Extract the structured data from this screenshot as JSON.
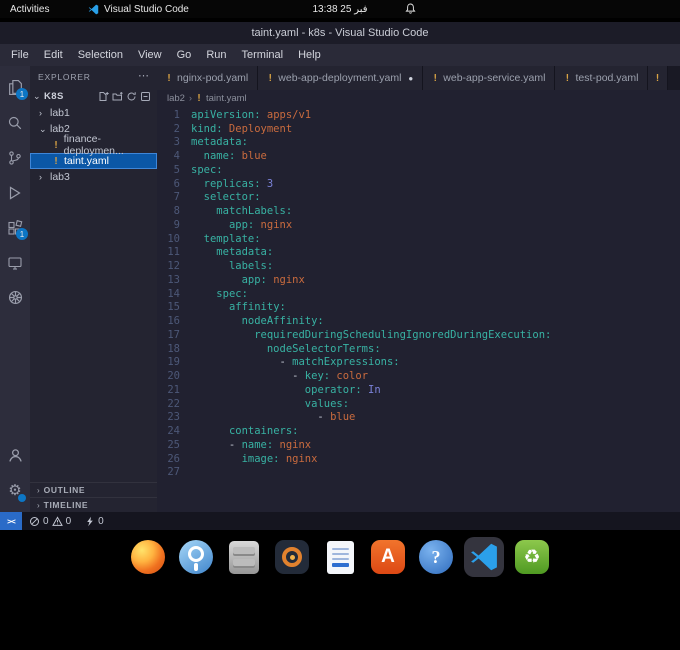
{
  "colors": {
    "accent": "#0a7fd4",
    "yaml_key": "#38b2a3",
    "yaml_value": "#c96b3e",
    "yaml_num": "#7b82d8",
    "selection": "#0b57a6",
    "remote": "#2a6bc8",
    "warning": "#d9a344",
    "topbar_bg": "#060606",
    "titlebar_bg": "#1c1c28",
    "menubar_bg": "#2a2a38",
    "activitybar_bg": "#2d2d3c",
    "sidebar_bg": "#242431",
    "editor_bg": "#212130",
    "tabbar_bg": "#191924",
    "tab_bg": "#242431",
    "statusbar_bg": "#15151f"
  },
  "topbar": {
    "activities": "Activities",
    "app_name": "Visual Studio Code",
    "clock": "13:38 25 فبر"
  },
  "titlebar": {
    "title": "taint.yaml - k8s - Visual Studio Code"
  },
  "menubar": {
    "items": [
      "File",
      "Edit",
      "Selection",
      "View",
      "Go",
      "Run",
      "Terminal",
      "Help"
    ]
  },
  "activity_bar": {
    "top": [
      {
        "name": "explorer",
        "badge": "1"
      },
      {
        "name": "search"
      },
      {
        "name": "source-control"
      },
      {
        "name": "run-debug"
      },
      {
        "name": "extensions",
        "badge": "1"
      },
      {
        "name": "remote-explorer"
      },
      {
        "name": "kubernetes"
      }
    ],
    "bottom": [
      {
        "name": "account"
      },
      {
        "name": "settings",
        "badge_dot": true
      }
    ]
  },
  "explorer": {
    "title": "EXPLORER",
    "actions_label": "⋯",
    "workspace": {
      "name": "K8S",
      "actions": [
        "new-file",
        "new-folder",
        "refresh-explorer",
        "collapse-folders"
      ]
    },
    "tree": [
      {
        "label": "lab1",
        "kind": "folder",
        "state": "collapsed",
        "level": 1
      },
      {
        "label": "lab2",
        "kind": "folder",
        "state": "expanded",
        "level": 1
      },
      {
        "label": "finance-deploymen...",
        "kind": "file",
        "icon": "!",
        "level": 2
      },
      {
        "label": "taint.yaml",
        "kind": "file",
        "icon": "!",
        "level": 2,
        "selected": true
      },
      {
        "label": "lab3",
        "kind": "folder",
        "state": "collapsed",
        "level": 1
      }
    ],
    "sections": [
      {
        "label": "OUTLINE"
      },
      {
        "label": "TIMELINE"
      }
    ]
  },
  "tabs": [
    {
      "label": "nginx-pod.yaml",
      "icon": "!"
    },
    {
      "label": "web-app-deployment.yaml",
      "icon": "!",
      "modified": true
    },
    {
      "label": "web-app-service.yaml",
      "icon": "!"
    },
    {
      "label": "test-pod.yaml",
      "icon": "!"
    },
    {
      "label": "",
      "icon": "!",
      "partial": true
    }
  ],
  "breadcrumb": {
    "items": [
      "lab2",
      "taint.yaml"
    ],
    "file_icon": "!"
  },
  "editor": {
    "lines": [
      [
        [
          "key",
          "apiVersion:"
        ],
        [
          "str",
          " apps/v1"
        ]
      ],
      [
        [
          "key",
          "kind:"
        ],
        [
          "str",
          " Deployment"
        ]
      ],
      [
        [
          "key",
          "metadata:"
        ]
      ],
      [
        [
          "pln",
          "  "
        ],
        [
          "key",
          "name:"
        ],
        [
          "str",
          " blue"
        ]
      ],
      [
        [
          "key",
          "spec:"
        ]
      ],
      [
        [
          "pln",
          "  "
        ],
        [
          "key",
          "replicas:"
        ],
        [
          "num",
          " 3"
        ]
      ],
      [
        [
          "pln",
          "  "
        ],
        [
          "key",
          "selector:"
        ]
      ],
      [
        [
          "pln",
          "    "
        ],
        [
          "key",
          "matchLabels:"
        ]
      ],
      [
        [
          "pln",
          "      "
        ],
        [
          "key",
          "app:"
        ],
        [
          "str",
          " nginx"
        ]
      ],
      [
        [
          "pln",
          "  "
        ],
        [
          "key",
          "template:"
        ]
      ],
      [
        [
          "pln",
          "    "
        ],
        [
          "key",
          "metadata:"
        ]
      ],
      [
        [
          "pln",
          "      "
        ],
        [
          "key",
          "labels:"
        ]
      ],
      [
        [
          "pln",
          "        "
        ],
        [
          "key",
          "app:"
        ],
        [
          "str",
          " nginx"
        ]
      ],
      [
        [
          "pln",
          "    "
        ],
        [
          "key",
          "spec:"
        ]
      ],
      [
        [
          "pln",
          "      "
        ],
        [
          "key",
          "affinity:"
        ]
      ],
      [
        [
          "pln",
          "        "
        ],
        [
          "key",
          "nodeAffinity:"
        ]
      ],
      [
        [
          "pln",
          "          "
        ],
        [
          "key",
          "requiredDuringSchedulingIgnoredDuringExecution:"
        ]
      ],
      [
        [
          "pln",
          "            "
        ],
        [
          "key",
          "nodeSelectorTerms:"
        ]
      ],
      [
        [
          "pln",
          "              - "
        ],
        [
          "key",
          "matchExpressions:"
        ]
      ],
      [
        [
          "pln",
          "                - "
        ],
        [
          "key",
          "key:"
        ],
        [
          "str",
          " color"
        ]
      ],
      [
        [
          "pln",
          "                  "
        ],
        [
          "key",
          "operator:"
        ],
        [
          "kw",
          " In"
        ]
      ],
      [
        [
          "pln",
          "                  "
        ],
        [
          "key",
          "values:"
        ]
      ],
      [
        [
          "pln",
          "                    - "
        ],
        [
          "str",
          "blue"
        ]
      ],
      [
        [
          "pln",
          "      "
        ],
        [
          "key",
          "containers:"
        ]
      ],
      [
        [
          "pln",
          "      - "
        ],
        [
          "key",
          "name:"
        ],
        [
          "str",
          " nginx"
        ]
      ],
      [
        [
          "pln",
          "        "
        ],
        [
          "key",
          "image:"
        ],
        [
          "str",
          " nginx"
        ]
      ],
      []
    ]
  },
  "status_bar": {
    "remote_glyph": "><",
    "errors": "0",
    "warnings": "0",
    "extra": "0"
  },
  "dock": {
    "items": [
      {
        "name": "firefox"
      },
      {
        "name": "web-browser"
      },
      {
        "name": "files"
      },
      {
        "name": "rhythmbox"
      },
      {
        "name": "libreoffice-writer"
      },
      {
        "name": "app-center",
        "glyph": "A"
      },
      {
        "name": "help",
        "glyph": "?"
      },
      {
        "name": "vscode",
        "active": true
      },
      {
        "name": "trash",
        "glyph": "♻"
      }
    ]
  }
}
